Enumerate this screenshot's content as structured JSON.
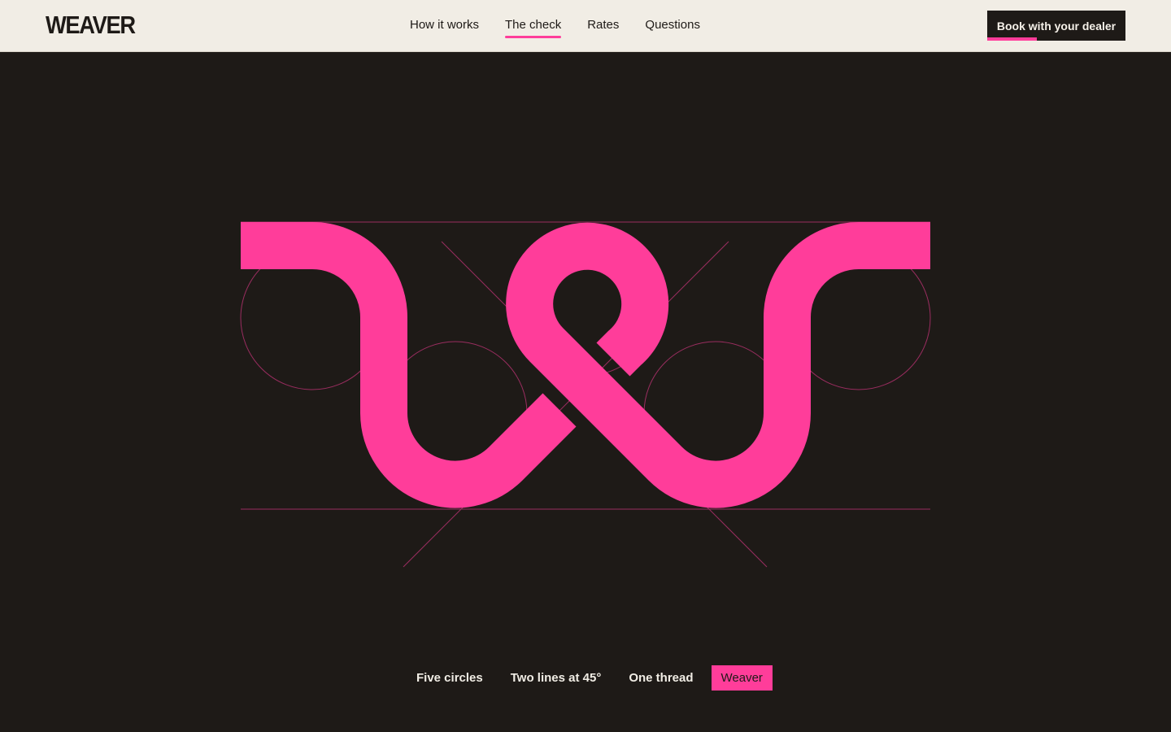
{
  "brand": {
    "logo": "WEAVER"
  },
  "nav": {
    "items": [
      {
        "label": "How it works",
        "active": false
      },
      {
        "label": "The check",
        "active": true
      },
      {
        "label": "Rates",
        "active": false
      },
      {
        "label": "Questions",
        "active": false
      }
    ]
  },
  "header": {
    "cta_label": "Book with your dealer"
  },
  "colors": {
    "accent": "#ff3d9a",
    "background": "#1e1a17",
    "topbar": "#f1ede5"
  },
  "construction": {
    "steps": [
      {
        "label": "Five circles",
        "active": false
      },
      {
        "label": "Two lines at 45°",
        "active": false
      },
      {
        "label": "One thread",
        "active": false
      },
      {
        "label": "Weaver",
        "active": true
      }
    ]
  }
}
